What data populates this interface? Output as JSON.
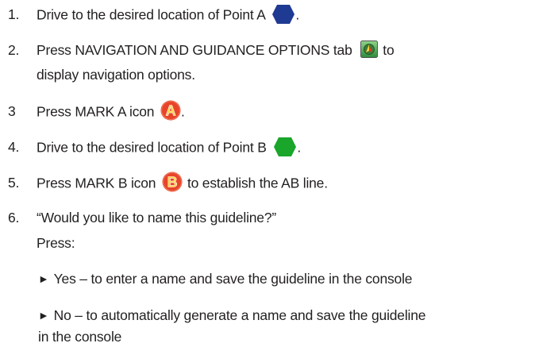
{
  "steps": [
    {
      "num": "1.",
      "text_before": "Drive to the desired location of Point A",
      "text_after": "."
    },
    {
      "num": "2.",
      "text_before": "Press NAVIGATION AND GUIDANCE OPTIONS tab",
      "text_after": "to",
      "continuation": "display navigation options."
    },
    {
      "num": "3",
      "text_before": "Press MARK A icon",
      "text_after": "."
    },
    {
      "num": "4.",
      "text_before": "Drive to the desired location of Point B",
      "text_after": "."
    },
    {
      "num": "5.",
      "text_before": "Press MARK B icon",
      "text_after": "to establish the AB line."
    },
    {
      "num": "6.",
      "text": "“Would you like to name this guideline?”",
      "press_label": "Press:"
    }
  ],
  "options": [
    {
      "text": "Yes – to enter a name and save the guideline in the console"
    },
    {
      "text": "No – to automatically generate a name and save the guideline",
      "continuation": "in the console"
    }
  ],
  "icons": {
    "point_a": {
      "name": "blue-hexagon-icon",
      "color": "#1f3a93"
    },
    "point_b": {
      "name": "green-hexagon-icon",
      "color": "#1aa52b"
    },
    "nav_tab": {
      "name": "navigation-guidance-tab-icon"
    },
    "mark_a": {
      "name": "mark-a-icon",
      "letter": "A",
      "color": "#e8442a"
    },
    "mark_b": {
      "name": "mark-b-icon",
      "letter": "B",
      "color": "#e8442a"
    }
  },
  "arrow_glyph": "►"
}
